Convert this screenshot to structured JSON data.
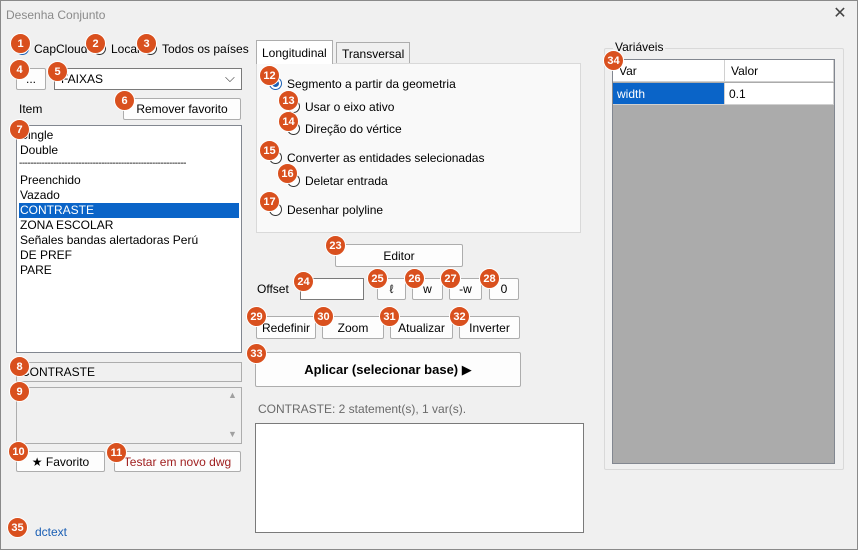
{
  "window": {
    "title": "Desenha Conjunto",
    "close_glyph": "✕"
  },
  "source": {
    "options": [
      {
        "label": "CapCloud",
        "selected": true
      },
      {
        "label": "Local",
        "selected": false
      },
      {
        "label": "Todos os países",
        "selected": false
      }
    ]
  },
  "family": {
    "browse_label": "...",
    "selected": "FAIXAS",
    "dropdown_glyph": "⌵"
  },
  "item": {
    "label": "Item",
    "remove_favorite_label": "Remover favorito",
    "list": [
      "Single",
      "Double",
      "-----------------------------------------------------------",
      "Preenchido",
      "Vazado",
      "CONTRASTE",
      "ZONA ESCOLAR",
      "Señales bandas alertadoras Perú",
      "DE PREF",
      "PARE"
    ],
    "selected_item": "CONTRASTE",
    "name_value": "CONTRASTE",
    "description_value": "",
    "favorite_label": "★ Favorito",
    "test_label": "Testar em novo dwg"
  },
  "tabs": [
    {
      "label": "Longitudinal",
      "active": true
    },
    {
      "label": "Transversal",
      "active": false
    }
  ],
  "longitudinal": {
    "options": [
      {
        "label": "Segmento a partir da geometria",
        "selected": true
      },
      {
        "label": "Usar o eixo ativo",
        "selected": false
      },
      {
        "label": "Direção do vértice",
        "selected": false
      },
      {
        "label": "Converter as entidades selecionadas",
        "selected": false
      },
      {
        "label": "Deletar entrada",
        "selected": false
      },
      {
        "label": "Desenhar polyline",
        "selected": false
      }
    ]
  },
  "tools": {
    "editor_label": "Editor",
    "offset_label": "Offset",
    "offset_value": "",
    "offset_buttons": [
      "ℓ",
      "w",
      "-w",
      "0"
    ],
    "actions": [
      "Redefinir",
      "Zoom",
      "Atualizar",
      "Inverter"
    ],
    "apply_label": "Aplicar (selecionar base) ▶",
    "status_text": "CONTRASTE: 2 statement(s), 1 var(s).",
    "output_text": ""
  },
  "variables": {
    "group_label": "Variáveis",
    "columns": [
      "Var",
      "Valor"
    ],
    "rows": [
      {
        "var": "width",
        "valor": "0.1"
      }
    ]
  },
  "footer": {
    "link_label": "dctext"
  },
  "badges": [
    "1",
    "2",
    "3",
    "4",
    "5",
    "6",
    "7",
    "8",
    "9",
    "10",
    "11",
    "12",
    "13",
    "14",
    "15",
    "16",
    "17",
    "23",
    "24",
    "25",
    "26",
    "27",
    "28",
    "29",
    "30",
    "31",
    "32",
    "33",
    "34",
    "35"
  ],
  "colors": {
    "accent": "#0a64c8",
    "badge": "#d9501e",
    "link": "#1a5fb4"
  }
}
